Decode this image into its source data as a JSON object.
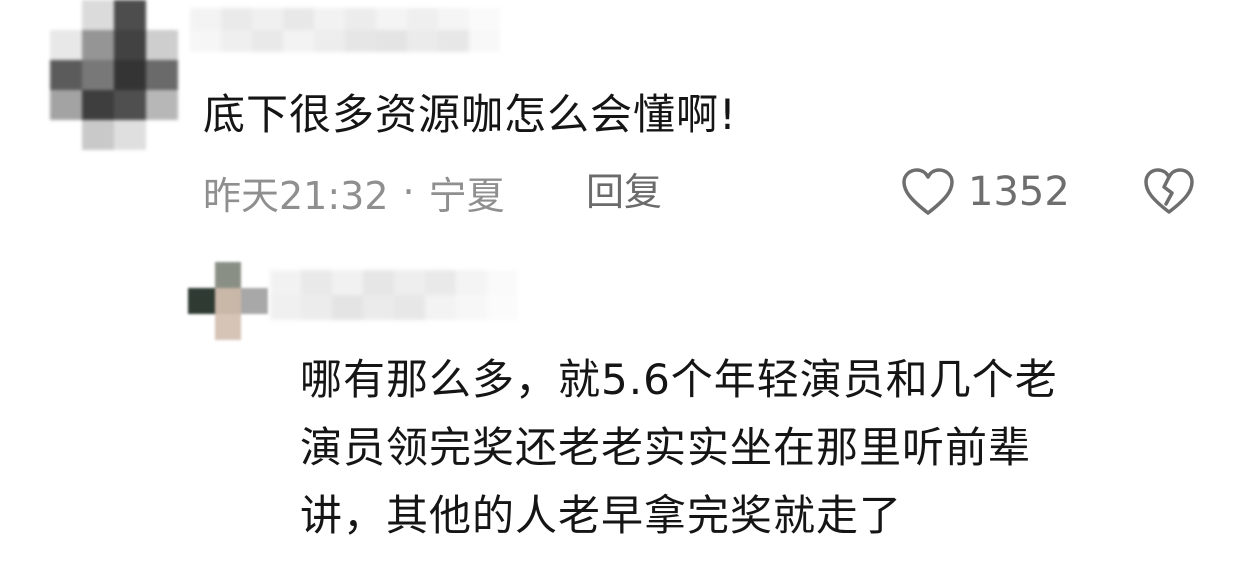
{
  "comment": {
    "text": "底下很多资源咖怎么会懂啊!",
    "timestamp": "昨天21:32",
    "separator": "·",
    "location": "宁夏",
    "reply_label": "回复",
    "like_count": "1352",
    "like_icon": "heart-outline-icon",
    "dislike_icon": "broken-heart-icon"
  },
  "reply": {
    "lines": [
      "哪有那么多，就5.6个年轻演员和几个老",
      "演员领完奖还老老实实坐在那里听前辈",
      "讲，其他的人老早拿完奖就走了"
    ]
  },
  "colors": {
    "text_primary": "#151515",
    "text_meta": "#8f8f8f",
    "icon": "#6e6e6e",
    "background": "#ffffff"
  }
}
